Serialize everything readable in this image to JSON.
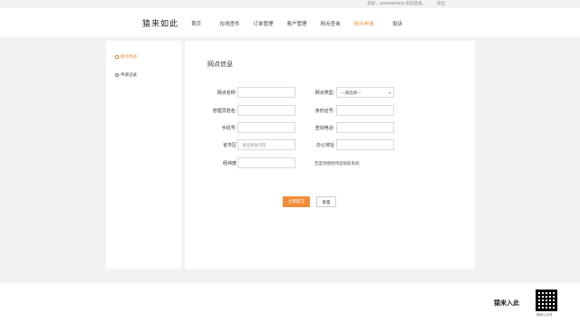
{
  "topbar": {
    "user_text": "您好，15305903900 欢迎登录。",
    "logout": "退出"
  },
  "header": {
    "logo": "猿来如此",
    "nav": [
      {
        "label": "首页",
        "active": false
      },
      {
        "label": "在线查件",
        "active": false
      },
      {
        "label": "订单管理",
        "active": false
      },
      {
        "label": "客户管理",
        "active": false
      },
      {
        "label": "网点查询",
        "active": false
      },
      {
        "label": "网点申请",
        "active": true
      },
      {
        "label": "投诉",
        "active": false
      }
    ]
  },
  "sidebar": {
    "items": [
      {
        "label": "网点申请",
        "active": true
      },
      {
        "label": "申请记录",
        "active": false
      }
    ]
  },
  "main": {
    "title": "网点信息",
    "form": {
      "outlet_name_label": "网点名称:",
      "outlet_type_label": "网点类型:",
      "outlet_type_value": "---请选择---",
      "manager_label": "管理员姓名:",
      "id_card_label": "身份证号:",
      "phone_label": "手机号:",
      "query_phone_label": "查询电话:",
      "region_label": "省市区",
      "region_placeholder": "请选择省市区",
      "office_label": "办公地址",
      "latlng_label": "经纬度",
      "latlng_hint": "百度地图经纬度拾取系统"
    },
    "submit_label": "立即提交",
    "reset_label": "重置"
  },
  "footer": {
    "brand": "猿来入此",
    "qr_caption": "微信公众号"
  },
  "colors": {
    "accent": "#f08c3b",
    "background": "#f2f2f2"
  }
}
